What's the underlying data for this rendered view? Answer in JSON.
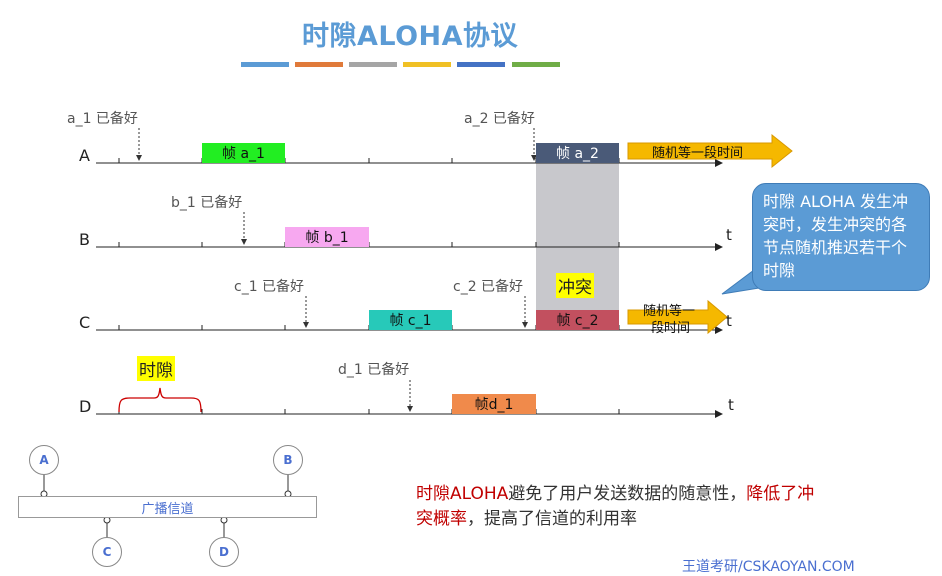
{
  "title": "时隙ALOHA协议",
  "color_bars": [
    "#5b9bd5",
    "#e07a3a",
    "#a5a5a5",
    "#f0c024",
    "#4472c4",
    "#70ad47"
  ],
  "rows": [
    {
      "label": "A"
    },
    {
      "label": "B",
      "t": "t"
    },
    {
      "label": "C",
      "t": "t"
    },
    {
      "label": "D",
      "t": "t"
    }
  ],
  "ready_labels": {
    "a1": "a_1 已备好",
    "a2": "a_2 已备好",
    "b1": "b_1 已备好",
    "c1": "c_1 已备好",
    "c2": "c_2 已备好",
    "d1": "d_1 已备好"
  },
  "frames": {
    "a1": {
      "label": "帧 a_1",
      "color": "#22ee22"
    },
    "a2": {
      "label": "帧 a_2",
      "color": "#4a5a78"
    },
    "b1": {
      "label": "帧 b_1",
      "color": "#f7a8f0"
    },
    "c1": {
      "label": "帧 c_1",
      "color": "#27c9b9"
    },
    "c2": {
      "label": "帧 c_2",
      "color": "#c2505f"
    },
    "d1": {
      "label": "帧d_1",
      "color": "#f08a4b"
    }
  },
  "arrows": {
    "a": "随机等一段时间",
    "c_line1": "随机等一",
    "c_line2": "段时间"
  },
  "collision_label": "冲突",
  "slot_label": "时隙",
  "callout": "时隙 ALOHA 发生冲突时，发生冲突的各节点随机推迟若干个时隙",
  "network": {
    "bus_label": "广播信道",
    "nodes": [
      "A",
      "B",
      "C",
      "D"
    ]
  },
  "summary": {
    "p1": "时隙ALOHA",
    "p2": "避免了用户发送数据的随意性，",
    "p3": "降低了冲突概率",
    "p4": "，提高了信道的利用率"
  },
  "footer": "王道考研/CSKAOYAN.COM"
}
